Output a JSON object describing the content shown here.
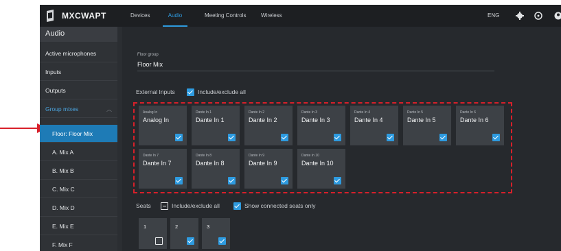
{
  "brand": {
    "name": "MXCWAPT",
    "logo_icon": "shure-logo-icon"
  },
  "nav": {
    "tabs": [
      {
        "label": "Devices",
        "active": false
      },
      {
        "label": "Audio",
        "active": true
      },
      {
        "label": "Meeting Controls",
        "active": false
      },
      {
        "label": "Wireless",
        "active": false
      }
    ],
    "language": "ENG",
    "icons": [
      "gear-icon",
      "help-icon",
      "account-icon"
    ]
  },
  "sidebar": {
    "title": "Audio",
    "items": [
      {
        "label": "Active microphones"
      },
      {
        "label": "Inputs"
      },
      {
        "label": "Outputs"
      },
      {
        "label": "Group mixes",
        "expanded": true
      },
      {
        "label": "Floor: Floor Mix",
        "selected": true
      },
      {
        "label": "A. Mix A"
      },
      {
        "label": "B. Mix B"
      },
      {
        "label": "C. Mix C"
      },
      {
        "label": "D. Mix D"
      },
      {
        "label": "E. Mix E"
      },
      {
        "label": "F. Mix F"
      }
    ]
  },
  "main": {
    "floor_group_label": "Floor group",
    "floor_group_value": "Floor Mix",
    "external_inputs_label": "External Inputs",
    "external_include_label": "Include/exclude all",
    "external_include_checked": true,
    "inputs": [
      {
        "small": "Analog In",
        "name": "Analog In",
        "checked": true
      },
      {
        "small": "Dante In 1",
        "name": "Dante In 1",
        "checked": true
      },
      {
        "small": "Dante In 2",
        "name": "Dante In 2",
        "checked": true
      },
      {
        "small": "Dante In 3",
        "name": "Dante In 3",
        "checked": true
      },
      {
        "small": "Dante In 4",
        "name": "Dante In 4",
        "checked": true
      },
      {
        "small": "Dante In 5",
        "name": "Dante In 5",
        "checked": true
      },
      {
        "small": "Dante In 6",
        "name": "Dante In 6",
        "checked": true
      },
      {
        "small": "Dante In 7",
        "name": "Dante In 7",
        "checked": true
      },
      {
        "small": "Dante In 8",
        "name": "Dante In 8",
        "checked": true
      },
      {
        "small": "Dante In 9",
        "name": "Dante In 9",
        "checked": true
      },
      {
        "small": "Dante In 10",
        "name": "Dante In 10",
        "checked": true
      }
    ],
    "seats_label": "Seats",
    "seats_include_label": "Include/exclude all",
    "seats_show_connected_label": "Show connected seats only",
    "seats_show_connected_checked": true,
    "seats": [
      {
        "name": "1",
        "checked": false
      },
      {
        "name": "2",
        "checked": true
      },
      {
        "name": "3",
        "checked": true
      }
    ]
  },
  "colors": {
    "accent": "#2e9be0",
    "highlight": "#d8202a",
    "selected": "#1e7bb6"
  }
}
